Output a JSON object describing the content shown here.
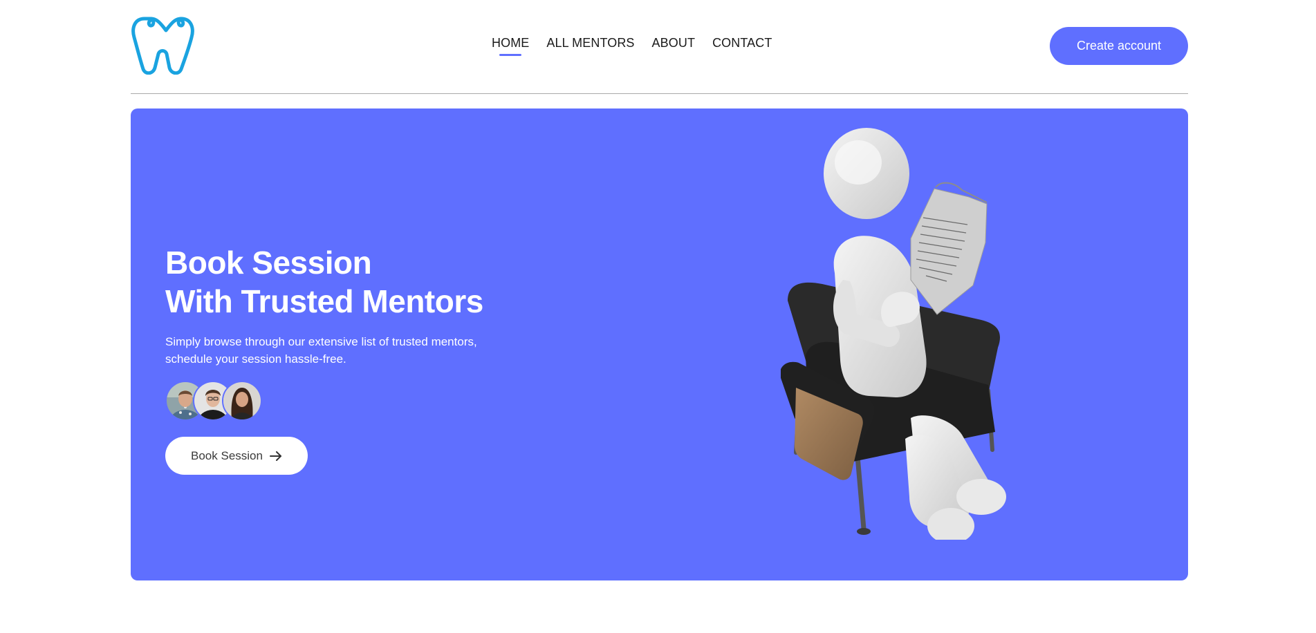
{
  "nav": {
    "items": [
      {
        "label": "HOME",
        "active": true
      },
      {
        "label": "ALL MENTORS"
      },
      {
        "label": "ABOUT"
      },
      {
        "label": "CONTACT"
      }
    ],
    "create_account_label": "Create account"
  },
  "hero": {
    "title_line1": "Book Session",
    "title_line2": "With Trusted Mentors",
    "subtitle_line1": "Simply browse through our extensive list of trusted mentors,",
    "subtitle_line2": "schedule your session hassle-free.",
    "cta_label": "Book Session",
    "cta_icon": "arrow-right-icon",
    "avatars": [
      "mentor-avatar",
      "mentor-avatar",
      "mentor-avatar"
    ]
  },
  "colors": {
    "accent": "#5f6fff",
    "logo": "#1aa3e0",
    "background": "#ffffff"
  }
}
